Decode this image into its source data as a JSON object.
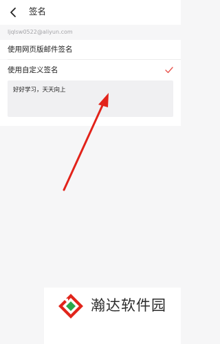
{
  "header": {
    "title": "签名",
    "back_icon": "chevron-left-icon"
  },
  "account": {
    "email": "ljqlsw0522@aliyun.com"
  },
  "options": {
    "web_signature_label": "使用网页版邮件签名",
    "custom_signature_label": "使用自定义签名",
    "custom_selected_icon": "checkmark-icon"
  },
  "signature": {
    "text": "好好学习，天天向上"
  },
  "colors": {
    "accent": "#e8554e",
    "arrow": "#e2231a"
  },
  "watermark": {
    "text": "瀚达软件园"
  }
}
